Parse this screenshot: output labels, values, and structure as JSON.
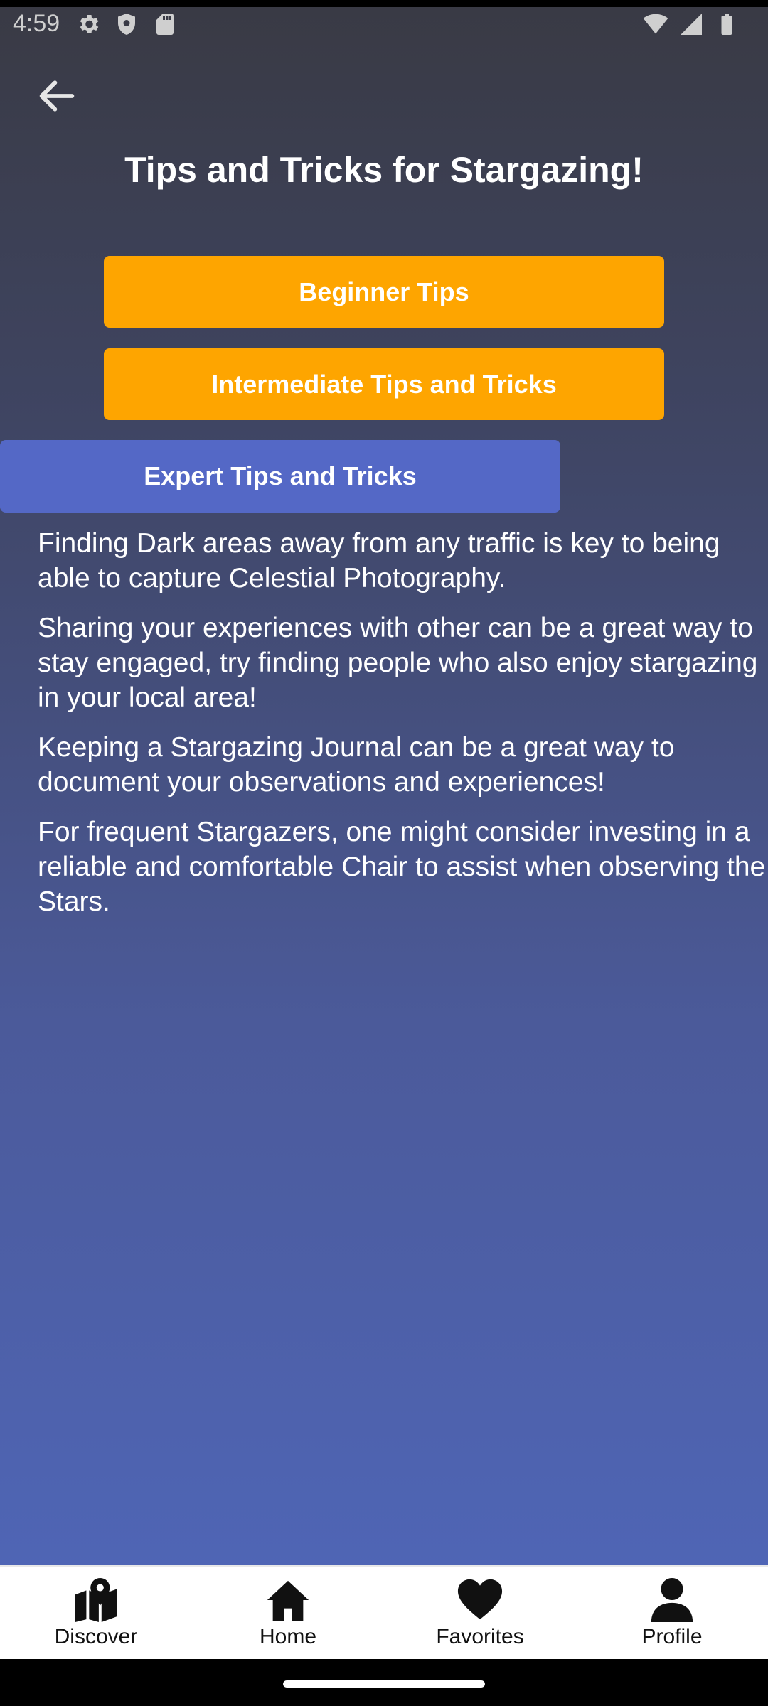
{
  "status_bar": {
    "time": "4:59",
    "left_icons": [
      "gear-icon",
      "shield-icon",
      "sd-card-icon"
    ],
    "right_icons": [
      "wifi-icon",
      "cell-signal-icon",
      "battery-icon"
    ]
  },
  "header": {
    "back_icon": "arrow-left-icon",
    "title": "Tips and Tricks for Stargazing!"
  },
  "buttons": {
    "beginner": "Beginner Tips",
    "intermediate": "Intermediate Tips and Tricks",
    "expert": "Expert Tips and Tricks"
  },
  "colors": {
    "beginner_button": "#fea500",
    "intermediate_button": "#fea500",
    "expert_button": "#5468c6",
    "background_top": "#393a44",
    "background_bottom": "#5068bc"
  },
  "tips": [
    "Finding Dark areas away from any traffic is key to being able to capture Celestial Photography.",
    "Sharing your experiences with other can be a great way to stay engaged, try finding people who also enjoy stargazing in your local area!",
    "Keeping a Stargazing Journal can be a great way to document your observations and experiences!",
    "For frequent Stargazers, one might consider investing in a reliable and comfortable Chair to assist when observing the Stars."
  ],
  "bottom_nav": {
    "items": [
      {
        "label": "Discover",
        "icon": "map-pin-icon"
      },
      {
        "label": "Home",
        "icon": "home-icon"
      },
      {
        "label": "Favorites",
        "icon": "heart-icon"
      },
      {
        "label": "Profile",
        "icon": "person-icon"
      }
    ]
  }
}
